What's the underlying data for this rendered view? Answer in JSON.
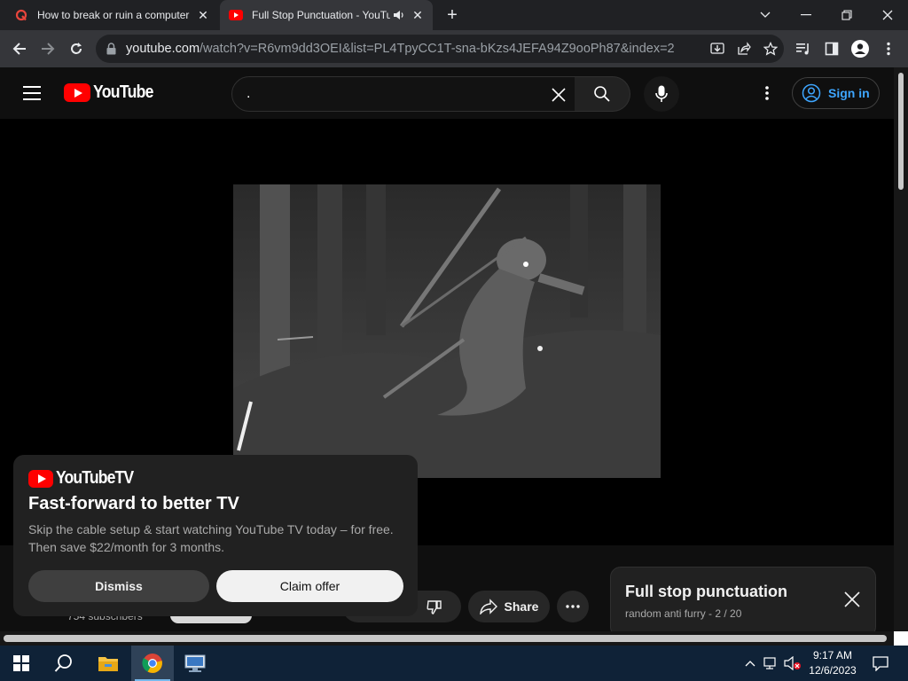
{
  "browser": {
    "tabs": [
      {
        "title": "How to break or ruin a computer",
        "favicon": "quora-icon",
        "active": false
      },
      {
        "title": "Full Stop Punctuation - YouTube",
        "favicon": "youtube-icon",
        "active": true,
        "audio": true
      }
    ],
    "url_host": "youtube.com",
    "url_path": "/watch?v=R6vm9dd3OEI&list=PL4TpyCC1T-sna-bKzs4JEFA94Z9ooPh87&index=2"
  },
  "youtube": {
    "logo_text": "YouTube",
    "search_value": ".",
    "signin_label": "Sign in"
  },
  "video_meta": {
    "subscribers": "754 subscribers",
    "share_label": "Share"
  },
  "playlist": {
    "title": "Full stop punctuation",
    "subtitle": "random anti furry - 2 / 20"
  },
  "promo": {
    "logo_text": "YouTubeTV",
    "headline": "Fast-forward to better TV",
    "body": "Skip the cable setup & start watching YouTube TV today – for free. Then save $22/month for 3 months.",
    "dismiss_label": "Dismiss",
    "claim_label": "Claim offer"
  },
  "taskbar": {
    "time": "9:17 AM",
    "date": "12/6/2023"
  },
  "colors": {
    "youtube_red": "#ff0000",
    "link_blue": "#3ea6ff",
    "page_bg": "#0f0f0f"
  }
}
